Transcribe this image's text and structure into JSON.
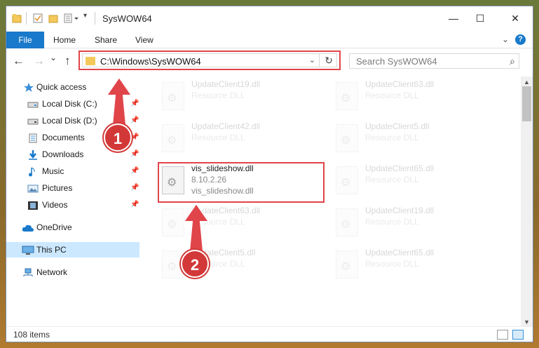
{
  "window": {
    "title": "SysWOW64"
  },
  "ribbon": {
    "tabs": [
      "File",
      "Home",
      "Share",
      "View"
    ],
    "help_label": "?"
  },
  "navigation": {
    "back_label": "←",
    "forward_label": "→",
    "recent_label": "⌄",
    "up_label": "↑",
    "address": "C:\\Windows\\SysWOW64",
    "search_placeholder": "Search SysWOW64"
  },
  "sidebar": {
    "quick_access": "Quick access",
    "items": [
      {
        "label": "Local Disk (C:)",
        "icon": "drive-icon",
        "pinned": true
      },
      {
        "label": "Local Disk (D:)",
        "icon": "drive-icon",
        "pinned": true
      },
      {
        "label": "Documents",
        "icon": "documents-icon",
        "pinned": true
      },
      {
        "label": "Downloads",
        "icon": "downloads-icon",
        "pinned": true
      },
      {
        "label": "Music",
        "icon": "music-icon",
        "pinned": true
      },
      {
        "label": "Pictures",
        "icon": "pictures-icon",
        "pinned": true
      },
      {
        "label": "Videos",
        "icon": "videos-icon",
        "pinned": true
      }
    ],
    "onedrive": "OneDrive",
    "this_pc": "This PC",
    "network": "Network"
  },
  "files": {
    "left_col": [
      {
        "name": "UpdateClient19.dll",
        "sub": "Resource DLL",
        "faded": true
      },
      {
        "name": "UpdateClient42.dll",
        "sub": "Resource DLL",
        "faded": true
      },
      {
        "name": "vis_slideshow.dll",
        "sub": "8.10.2.26",
        "sub2": "vis_slideshow.dll",
        "faded": false
      },
      {
        "name": "UpdateClient63.dll",
        "sub": "Resource DLL",
        "faded": true
      },
      {
        "name": "UpdateClient5.dll",
        "sub": "Resource DLL",
        "faded": true
      }
    ],
    "right_col": [
      {
        "name": "UpdateClient63.dll",
        "sub": "Resource DLL",
        "faded": true
      },
      {
        "name": "UpdateClient5.dll",
        "sub": "Resource DLL",
        "faded": true
      },
      {
        "name": "UpdateClient65.dll",
        "sub": "Resource DLL",
        "faded": true
      },
      {
        "name": "UpdateClient19.dll",
        "sub": "Resource DLL",
        "faded": true
      },
      {
        "name": "UpdateClient65.dll",
        "sub": "Resource DLL",
        "faded": true
      }
    ]
  },
  "status": {
    "item_count": "108 items"
  },
  "annotations": {
    "step1": "1",
    "step2": "2"
  },
  "colors": {
    "accent": "#1979ca",
    "highlight": "#e0454a",
    "selected": "#cce8ff"
  }
}
